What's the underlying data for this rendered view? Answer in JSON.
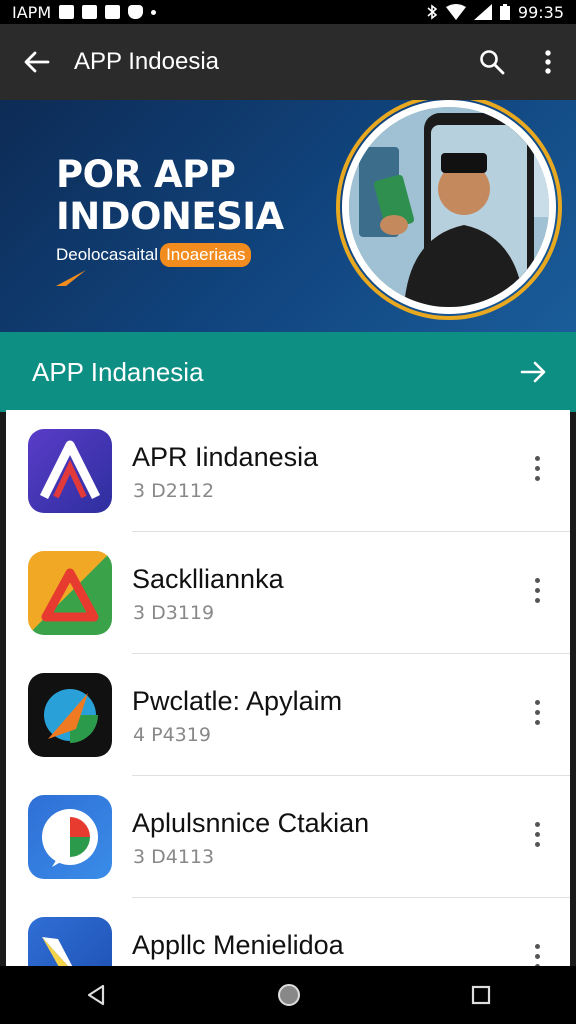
{
  "status_bar": {
    "carrier": "IAPM",
    "time": "99:35"
  },
  "app_bar": {
    "title": "APP Indoesia",
    "back_icon": "back-arrow-icon",
    "search_icon": "search-icon",
    "menu_icon": "more-vert-icon"
  },
  "hero": {
    "title_line1": "POR APP",
    "title_line2": "INDONESIA",
    "subtitle": "Deolocasaital",
    "subtitle_tag": "Inoaeriaas"
  },
  "section": {
    "label": "APP Indanesia",
    "arrow_icon": "arrow-right-icon"
  },
  "apps": [
    {
      "name": "APR Iindanesia",
      "meta": "3 D2112"
    },
    {
      "name": "Sacklliannka",
      "meta": "3 D3119"
    },
    {
      "name": "Pwclatle: Apylaim",
      "meta": "4 P4319"
    },
    {
      "name": "Aplulsnnice Ctakian",
      "meta": "3 D4113"
    },
    {
      "name": "Appllc Menielidoa",
      "meta": ""
    }
  ],
  "nav": {
    "back_icon": "nav-back-icon",
    "home_icon": "nav-home-icon",
    "recents_icon": "nav-recents-icon"
  }
}
